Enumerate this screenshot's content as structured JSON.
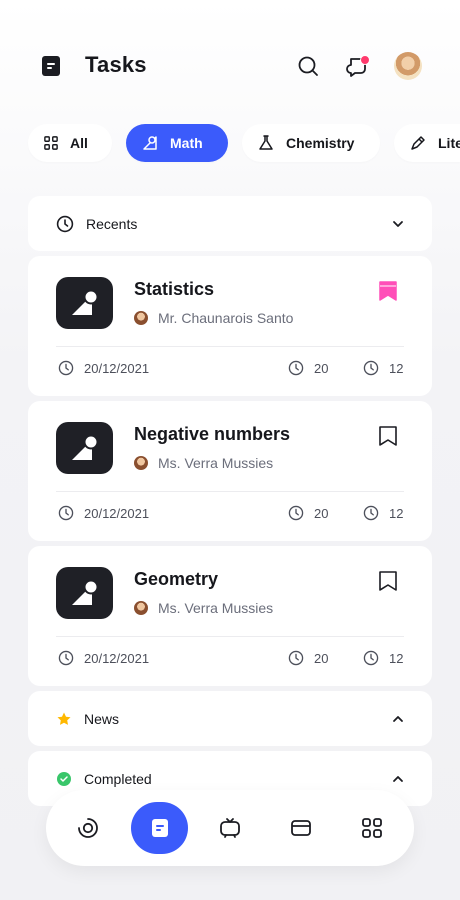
{
  "header": {
    "title": "Tasks",
    "icons": [
      "document-icon",
      "search-icon",
      "chat-icon",
      "avatar"
    ],
    "notification_color": "#ff3a6d"
  },
  "filters": [
    {
      "label": "All",
      "icon": "grid-icon",
      "active": false
    },
    {
      "label": "Math",
      "icon": "shapes-icon",
      "active": true
    },
    {
      "label": "Chemistry",
      "icon": "flask-icon",
      "active": false
    },
    {
      "label": "Lite",
      "icon": "pencil-icon",
      "active": false
    }
  ],
  "sections": {
    "recents": {
      "label": "Recents",
      "icon": "clock-icon"
    },
    "news": {
      "label": "News",
      "icon": "star-icon"
    },
    "completed": {
      "label": "Completed",
      "icon": "check-circle-icon"
    }
  },
  "tasks": [
    {
      "title": "Statistics",
      "teacher": "Mr. Chaunarois Santo",
      "date": "20/12/2021",
      "count_a": "20",
      "count_b": "12",
      "bookmarked": true
    },
    {
      "title": "Negative numbers",
      "teacher": "Ms. Verra Mussies",
      "date": "20/12/2021",
      "count_a": "20",
      "count_b": "12",
      "bookmarked": false
    },
    {
      "title": "Geometry",
      "teacher": "Ms. Verra Mussies",
      "date": "20/12/2021",
      "count_a": "20",
      "count_b": "12",
      "bookmarked": false
    }
  ],
  "bottom_nav": [
    "target-icon",
    "document-icon",
    "tv-icon",
    "card-icon",
    "apps-icon"
  ],
  "colors": {
    "accent": "#3b5bfb",
    "bookmark": "#ff4fb8",
    "star": "#ffb800",
    "check": "#39c66a",
    "dark": "#1f2026"
  }
}
